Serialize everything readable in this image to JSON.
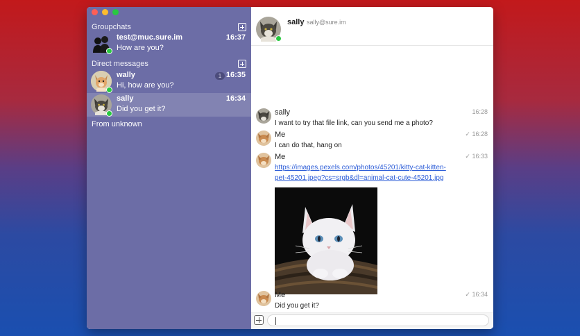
{
  "sidebar": {
    "groupchats_label": "Groupchats",
    "direct_label": "Direct messages",
    "from_unknown_label": "From unknown",
    "groupchats": [
      {
        "name": "test@muc.sure.im",
        "preview": "How are you?",
        "time": "16:37"
      }
    ],
    "direct": [
      {
        "name": "wally",
        "preview": "Hi, how are you?",
        "time": "16:35",
        "unread": "1"
      },
      {
        "name": "sally",
        "preview": "Did you get it?",
        "time": "16:34"
      }
    ]
  },
  "chat": {
    "contact_name": "sally",
    "contact_jid": "sally@sure.im",
    "messages": [
      {
        "sender": "sally",
        "text": "I want to try that file link, can you send me a photo?",
        "time": "16:28"
      },
      {
        "sender": "Me",
        "text": "I can do that, hang on",
        "time": "✓ 16:28"
      },
      {
        "sender": "Me",
        "link": "https://images.pexels.com/photos/45201/kitty-cat-kitten-pet-45201.jpeg?cs=srgb&dl=animal-cat-cute-45201.jpg",
        "time": "✓ 16:33"
      },
      {
        "sender": "Me",
        "text": "Did you get it?",
        "time": "✓ 16:34"
      }
    ],
    "composer_placeholder": ""
  },
  "colors": {
    "sidebar_bg": "#6c6da6",
    "sidebar_selected": "#8283b2",
    "online_status": "#27c93f",
    "link": "#2a5bd7"
  },
  "icons": [
    "close-window-icon",
    "minimize-window-icon",
    "zoom-window-icon",
    "add-groupchat-icon",
    "add-direct-icon",
    "attach-icon",
    "sent-check-icon"
  ]
}
